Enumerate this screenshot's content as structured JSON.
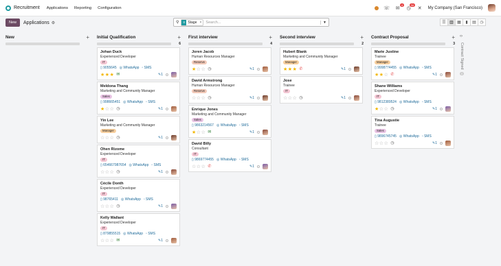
{
  "topbar": {
    "app_name": "Recruitment",
    "menu": [
      "Applications",
      "Reporting",
      "Configuration"
    ],
    "company": "My Company (San Francisco)",
    "messages_badge": "4",
    "activity_badge": "34"
  },
  "control": {
    "new_label": "New",
    "breadcrumb": "Applications"
  },
  "search": {
    "facet_label": "Stage",
    "placeholder": "Search..."
  },
  "columns": [
    {
      "title": "New",
      "count": "",
      "progress": 0,
      "cards": []
    },
    {
      "title": "Initial Qualification",
      "count": "6",
      "progress": 0,
      "cards": [
        {
          "name": "Johan Duck",
          "job": "Experienced Developer",
          "tag": "IT",
          "tag_color": "#f4c6d3",
          "phone": "9055645",
          "whatsapp": "WhatsApp",
          "sms": "SMS",
          "stars": 3,
          "activity": "email-icon",
          "attachments": "1"
        },
        {
          "name": "Meldona Thang",
          "job": "Marketing and Community Manager",
          "tag": "Sales",
          "tag_color": "#e9c4e4",
          "phone": "998665451",
          "whatsapp": "WhatsApp",
          "sms": "SMS",
          "stars": 1,
          "activity": "clock-icon",
          "attachments": "1"
        },
        {
          "name": "Yin Lee",
          "job": "Marketing and Community Manager",
          "tag": "Manager",
          "tag_color": "#f7cf9e",
          "phone": "",
          "whatsapp": "",
          "sms": "",
          "stars": 0,
          "activity": "clock-icon",
          "attachments": "1"
        },
        {
          "name": "Ohen Rizome",
          "job": "Experienced Developer",
          "tag": "IT",
          "tag_color": "#f4c6d3",
          "phone": "654667987654",
          "whatsapp": "WhatsApp",
          "sms": "SMS",
          "stars": 0,
          "activity": "clock-icon",
          "attachments": "1"
        },
        {
          "name": "Cécile Donth",
          "job": "Experienced Developer",
          "tag": "IT",
          "tag_color": "#f4c6d3",
          "phone": "98765411",
          "whatsapp": "WhatsApp",
          "sms": "SMS",
          "stars": 0,
          "activity": "clock-icon",
          "attachments": "1"
        },
        {
          "name": "Kelly Wallant",
          "job": "Experienced Developer",
          "tag": "IT",
          "tag_color": "#f4c6d3",
          "phone": "879855515",
          "whatsapp": "WhatsApp",
          "sms": "SMS",
          "stars": 0,
          "activity": "email-icon",
          "attachments": "1"
        }
      ]
    },
    {
      "title": "First interview",
      "count": "4",
      "progress": 0,
      "cards": [
        {
          "name": "Joren Jacob",
          "job": "Human Resources Manager",
          "tag": "Reserve",
          "tag_color": "#f2c9b8",
          "phone": "",
          "whatsapp": "",
          "sms": "",
          "stars": 1,
          "activity": "clock-icon",
          "attachments": "1"
        },
        {
          "name": "David Armstrong",
          "job": "Human Resources Manager",
          "tag": "Reserve",
          "tag_color": "#f2c9b8",
          "phone": "",
          "whatsapp": "",
          "sms": "",
          "stars": 0,
          "activity": "clock-icon",
          "attachments": "1"
        },
        {
          "name": "Enrique Jones",
          "job": "Marketing and Community Manager",
          "tag": "Sales",
          "tag_color": "#e9c4e4",
          "phone": "9863214567",
          "whatsapp": "WhatsApp",
          "sms": "SMS",
          "stars": 1,
          "activity": "email-icon",
          "attachments": "1"
        },
        {
          "name": "David Billy",
          "job": "Consultant",
          "tag": "IT",
          "tag_color": "#f4c6d3",
          "phone": "9869774455",
          "whatsapp": "WhatsApp",
          "sms": "SMS",
          "stars": 0,
          "activity": "phone-icon",
          "attachments": "1"
        }
      ]
    },
    {
      "title": "Second interview",
      "count": "2",
      "progress": 0,
      "cards": [
        {
          "name": "Hubert Blank",
          "job": "Marketing and Community Manager",
          "tag": "Manager",
          "tag_color": "#f7cf9e",
          "phone": "",
          "whatsapp": "",
          "sms": "",
          "stars": 3,
          "activity": "phone-icon",
          "attachments": "1"
        },
        {
          "name": "Jose",
          "job": "Trainee",
          "tag": "IT",
          "tag_color": "#f4c6d3",
          "phone": "",
          "whatsapp": "",
          "sms": "",
          "stars": 0,
          "activity": "clock-icon",
          "attachments": "1"
        }
      ]
    },
    {
      "title": "Contract Proposal",
      "count": "3",
      "progress": 0,
      "cards": [
        {
          "name": "Marie Justine",
          "job": "Trainee",
          "tag": "Manager",
          "tag_color": "#f7cf9e",
          "phone": "9998774455",
          "whatsapp": "WhatsApp",
          "sms": "SMS",
          "stars": 2,
          "activity": "phone-icon",
          "attachments": "1"
        },
        {
          "name": "Shane Williams",
          "job": "Experienced Developer",
          "tag": "IT",
          "tag_color": "#f4c6d3",
          "phone": "9812389524",
          "whatsapp": "WhatsApp",
          "sms": "SMS",
          "stars": 1,
          "activity": "clock-icon",
          "attachments": "1"
        },
        {
          "name": "Tina Augustie",
          "job": "Trainee",
          "tag": "Sales",
          "tag_color": "#e9c4e4",
          "phone": "9896745745",
          "whatsapp": "WhatsApp",
          "sms": "SMS",
          "stars": 0,
          "activity": "clock-icon",
          "attachments": "1"
        }
      ]
    }
  ],
  "folded_column": {
    "title": "Contract Signed",
    "count": "0"
  }
}
